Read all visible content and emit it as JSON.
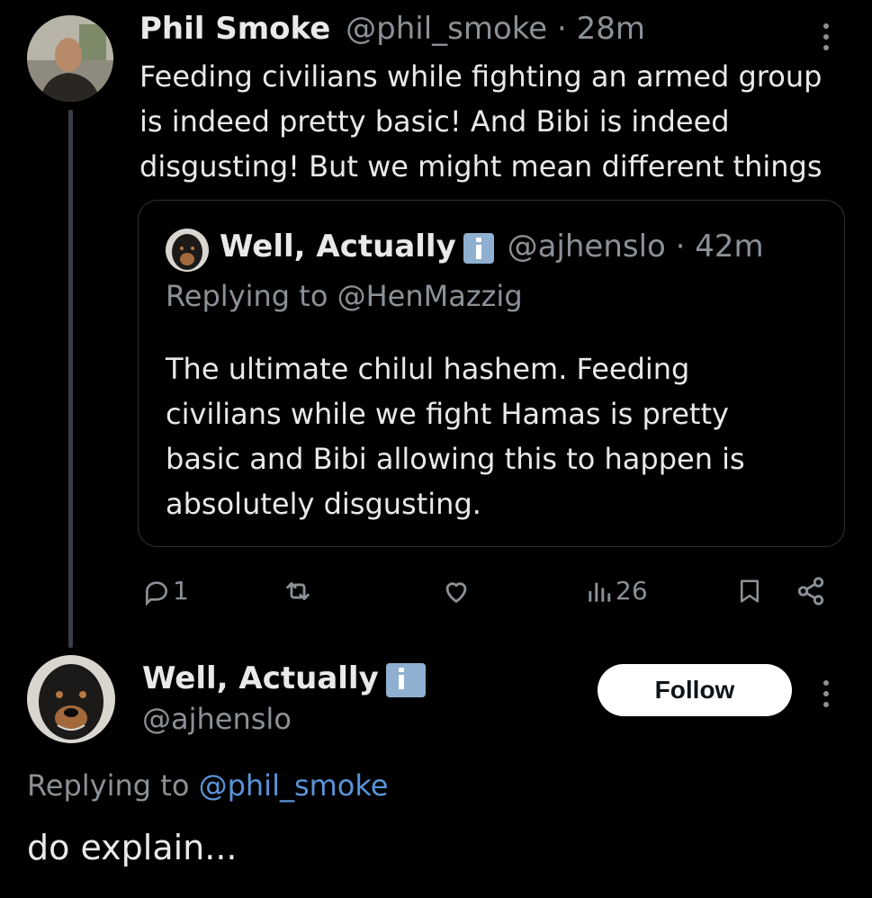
{
  "tweet1": {
    "author_name": "Phil Smoke",
    "handle": "@phil_smoke",
    "separator": "·",
    "time": "28m",
    "text_lines": [
      "Feeding civilians while fighting an armed group",
      "is indeed pretty basic! And Bibi is indeed",
      "disgusting! But we might mean different things"
    ],
    "quoted": {
      "author_name": "Well, Actually",
      "handle": "@ajhenslo",
      "separator": "·",
      "time": "42m",
      "replying_to": "Replying to @HenMazzig",
      "text_lines": [
        "The ultimate chilul hashem. Feeding",
        "civilians while we fight Hamas is pretty",
        "basic and Bibi allowing this to happen is",
        "absolutely disgusting."
      ]
    },
    "actions": {
      "reply_count": "1",
      "views_count": "26"
    }
  },
  "tweet2": {
    "author_name": "Well, Actually",
    "handle": "@ajhenslo",
    "follow_label": "Follow",
    "replying_prefix": "Replying to",
    "replying_handle": "@phil_smoke",
    "text": "do explain..."
  },
  "colors": {
    "background": "#000000",
    "text": "#e7e9ea",
    "muted": "#8b9196",
    "link": "#5a93d8",
    "badge": "#8fb0d0"
  }
}
